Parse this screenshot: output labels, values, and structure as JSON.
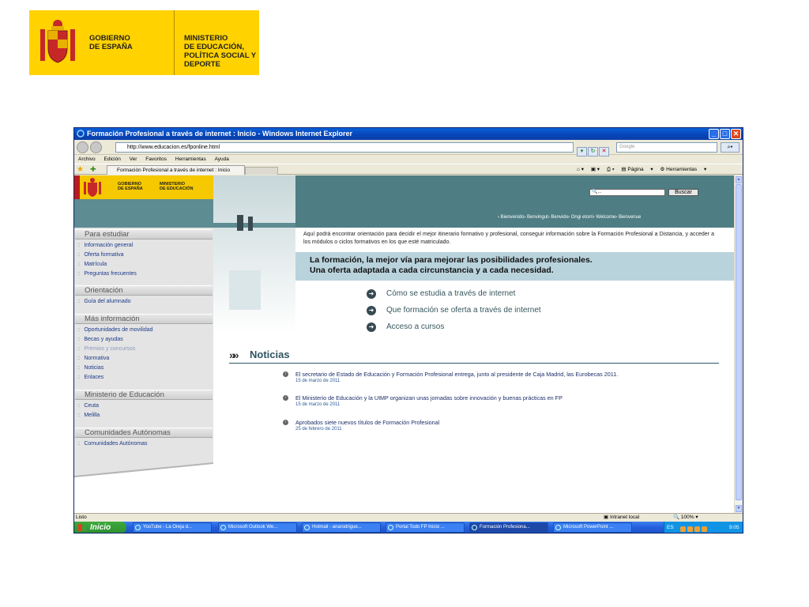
{
  "slide_logo": {
    "gov_line1": "GOBIERNO",
    "gov_line2": "DE ESPAÑA",
    "ministry_line1": "MINISTERIO",
    "ministry_line2": "DE EDUCACIÓN,",
    "ministry_line3": "POLÍTICA SOCIAL Y DEPORTE"
  },
  "window": {
    "title": "Formación Profesional a través de internet : Inicio - Windows Internet Explorer",
    "address": "http://www.educacion.es/fponline.html",
    "search_placeholder": "Google",
    "menu": [
      "Archivo",
      "Edición",
      "Ver",
      "Favoritos",
      "Herramientas",
      "Ayuda"
    ],
    "tab_title": "Formación Profesional a través de internet : Inicio",
    "commands": {
      "page": "Página",
      "tools": "Herramientas"
    }
  },
  "site": {
    "logo_gov_1": "GOBIERNO",
    "logo_gov_2": "DE ESPAÑA",
    "logo_min_1": "MINISTERIO",
    "logo_min_2": "DE EDUCACIÓN",
    "search_value": "...",
    "search_button": "Buscar",
    "languages": "› Bienvenido› Benvingut› Benvido› Ongi etorri› Welcome› Bienvenue",
    "nav": {
      "estudiar_head": "Para estudiar",
      "estudiar_items": [
        "Información general",
        "Oferta formativa",
        "Matrícula",
        "Preguntas frecuentes"
      ],
      "orientacion_head": "Orientación",
      "orientacion_items": [
        "Guía del alumnado"
      ],
      "mas_head": "Más información",
      "mas_items": [
        "Oportunidades de movilidad",
        "Becas y ayudas",
        "Premios y concursos",
        "Normativa",
        "Noticias",
        "Enlaces"
      ],
      "ministerio_head": "Ministerio de Educación",
      "ministerio_items": [
        "Ceuta",
        "Melilla"
      ],
      "ccaa_head": "Comunidades Autónomas",
      "ccaa_items": [
        "Comunidades Autónomas"
      ]
    },
    "intro": "Aquí podrá encontrar orientación para decidir el mejor itinerario formativo y profesional, conseguir información sobre la Formación Profesional a Distancia, y acceder a los módulos o ciclos formativos en los que esté matriculado.",
    "tagline_1": "La formación, la mejor vía para mejorar las posibilidades profesionales.",
    "tagline_2": "Una oferta adaptada a cada circunstancia y a cada necesidad.",
    "cta": [
      "Cómo se estudia a través de internet",
      "Que formación se oferta a través de internet",
      "Acceso a cursos"
    ],
    "news_title": "Noticias",
    "news": [
      {
        "headline": "El secretario de Estado de Educación y Formación Profesional entrega, junto al presidente de Caja Madrid, las Eurobecas 2011.",
        "date": "15 de marzo de 2011"
      },
      {
        "headline": "El Ministerio de Educación y la UIMP organizan unas jornadas sobre innovación y buenas prácticas en FP",
        "date": "15 de marzo de 2011"
      },
      {
        "headline": "Aprobados siete nuevos títulos de Formación Profesional",
        "date": "25 de febrero de 2011"
      }
    ]
  },
  "status": {
    "left": "Listo",
    "zone": "Intranet local",
    "zoom": "100%"
  },
  "taskbar": {
    "start": "Inicio",
    "tasks": [
      "YouTube - La Oreja d...",
      "Microsoft Outlook We...",
      "Hotmail - anarodrigue...",
      "Portal Todo FP Inicio ...",
      "Formación Profesiona...",
      "Microsoft PowerPoint ..."
    ],
    "lang": "ES",
    "clock": "9:05"
  }
}
